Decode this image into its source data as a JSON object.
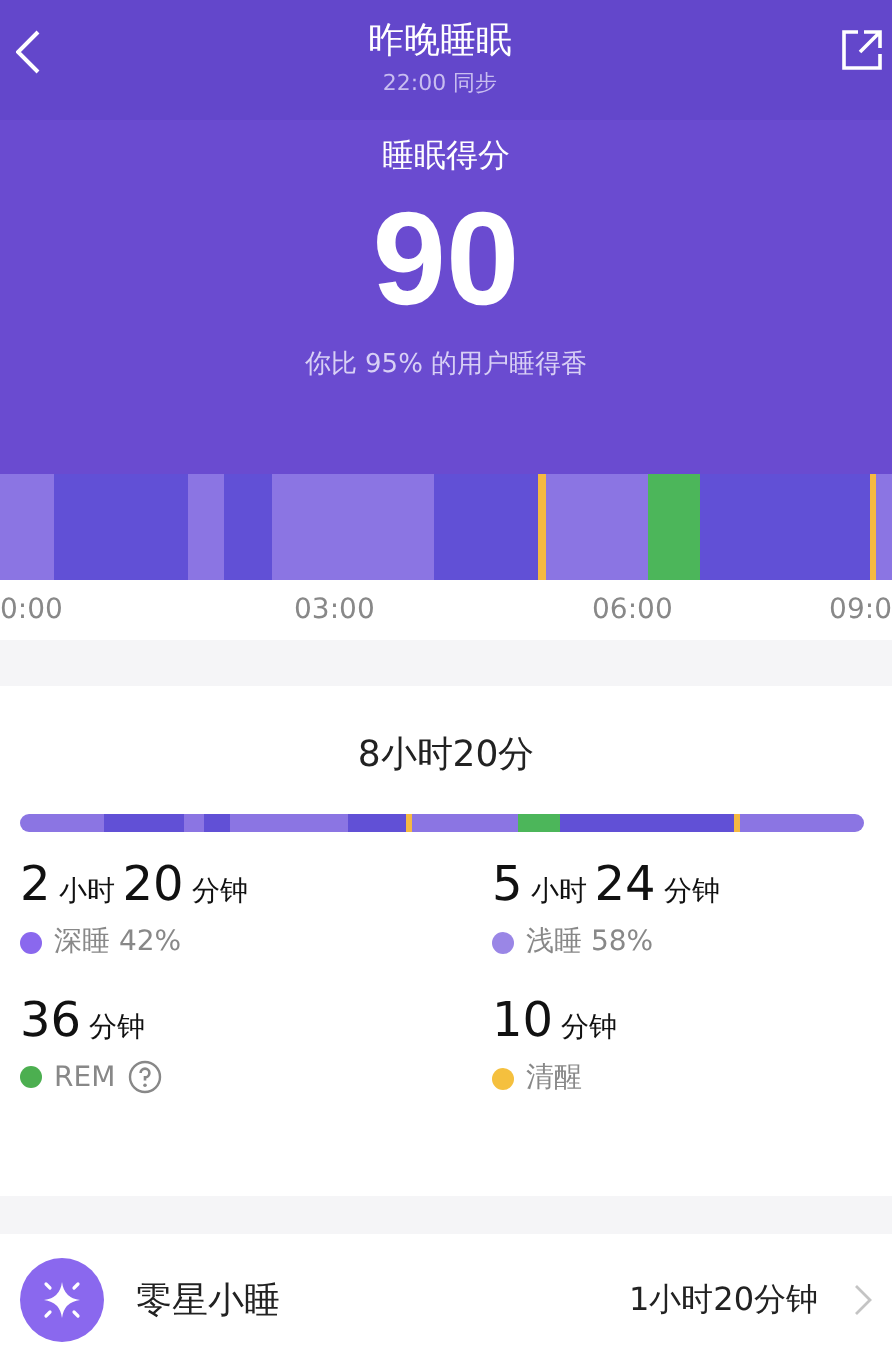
{
  "header": {
    "title": "昨晚睡眠",
    "subtitle": "22:00 同步"
  },
  "score": {
    "label": "睡眠得分",
    "value": "90",
    "comparison": "你比 95% 的用户睡得香"
  },
  "timeline": {
    "axis_labels": [
      "0:00",
      "03:00",
      "06:00",
      "09:0"
    ]
  },
  "summary": {
    "total": "8小时20分",
    "stats": [
      {
        "parts": [
          {
            "kind": "number",
            "text": "2"
          },
          {
            "kind": "unit",
            "text": "小时"
          },
          {
            "kind": "number",
            "text": "20"
          },
          {
            "kind": "unit",
            "text": "分钟"
          }
        ],
        "label": "深睡 42%",
        "color": "#8a68ee",
        "help": false
      },
      {
        "parts": [
          {
            "kind": "number",
            "text": "5"
          },
          {
            "kind": "unit",
            "text": "小时"
          },
          {
            "kind": "number",
            "text": "24"
          },
          {
            "kind": "unit",
            "text": "分钟"
          }
        ],
        "label": "浅睡 58%",
        "color": "#9a86e6",
        "help": false
      },
      {
        "parts": [
          {
            "kind": "number",
            "text": "36"
          },
          {
            "kind": "unit",
            "text": "分钟"
          }
        ],
        "label": "REM",
        "color": "#4caf50",
        "help": true
      },
      {
        "parts": [
          {
            "kind": "number",
            "text": "10"
          },
          {
            "kind": "unit",
            "text": "分钟"
          }
        ],
        "label": "清醒",
        "color": "#f5c03e",
        "help": false
      }
    ]
  },
  "nap": {
    "title": "零星小睡",
    "value": "1小时20分钟"
  }
}
